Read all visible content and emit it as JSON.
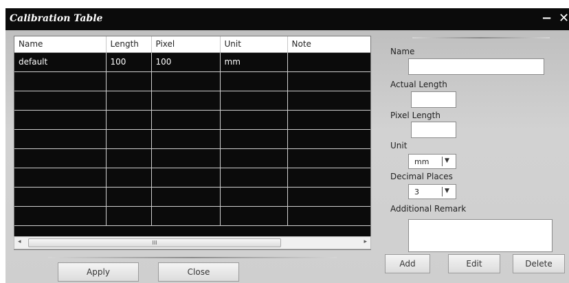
{
  "window": {
    "title": "Calibration Table",
    "minimize_label": "−",
    "close_label": "✕"
  },
  "table": {
    "columns": [
      "Name",
      "Length",
      "Pixel",
      "Unit",
      "Note"
    ],
    "rows": [
      [
        "default",
        "100",
        "100",
        "mm",
        ""
      ],
      [
        "",
        "",
        "",
        "",
        ""
      ],
      [
        "",
        "",
        "",
        "",
        ""
      ],
      [
        "",
        "",
        "",
        "",
        ""
      ],
      [
        "",
        "",
        "",
        "",
        ""
      ],
      [
        "",
        "",
        "",
        "",
        ""
      ],
      [
        "",
        "",
        "",
        "",
        ""
      ],
      [
        "",
        "",
        "",
        "",
        ""
      ],
      [
        "",
        "",
        "",
        "",
        ""
      ]
    ],
    "scroll_left_icon": "◂",
    "scroll_right_icon": "▸",
    "scroll_thumb_grip": "III"
  },
  "buttons": {
    "apply": "Apply",
    "close": "Close",
    "add": "Add",
    "edit": "Edit",
    "delete": "Delete"
  },
  "form": {
    "name_label": "Name",
    "name_value": "",
    "actual_length_label": "Actual Length",
    "actual_length_value": "",
    "pixel_length_label": "Pixel Length",
    "pixel_length_value": "",
    "unit_label": "Unit",
    "unit_value": "mm",
    "decimal_places_label": "Decimal Places",
    "decimal_places_value": "3",
    "remark_label": "Additional Remark",
    "remark_value": "",
    "dropdown_icon": "▼"
  }
}
